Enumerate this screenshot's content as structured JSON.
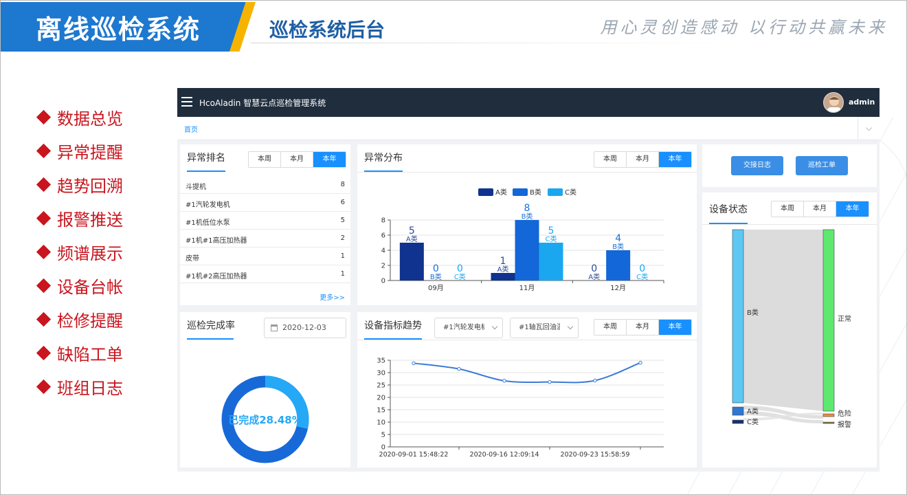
{
  "banner": {
    "title": "离线巡检系统",
    "subtitle": "巡检系统后台",
    "slogan": "用心灵创造感动 以行动共赢未来",
    "colors": {
      "blue": "#1d78cf",
      "yellow": "#f6b400"
    }
  },
  "features": [
    "数据总览",
    "异常提醒",
    "趋势回溯",
    "报警推送",
    "频谱展示",
    "设备台帐",
    "检修提醒",
    "缺陷工单",
    "班组日志"
  ],
  "app": {
    "title": "HcoAladin 智慧云点巡检管理系统",
    "user": "admin",
    "menu_icon": "hamburger-icon",
    "home_tab": "首页",
    "period_options": [
      "本周",
      "本月",
      "本年"
    ],
    "active_period": "本年",
    "anomaly_ranking": {
      "title": "异常排名",
      "rows": [
        {
          "name": "斗提机",
          "value": "8"
        },
        {
          "name": "#1汽轮发电机",
          "value": "6"
        },
        {
          "name": "#1机低位水泵",
          "value": "5"
        },
        {
          "name": "#1机#1高压加热器",
          "value": "2"
        },
        {
          "name": "皮带",
          "value": "1"
        },
        {
          "name": "#1机#2高压加热器",
          "value": "1"
        }
      ],
      "more": "更多>>"
    },
    "completion": {
      "title": "巡检完成率",
      "date": "2020-12-03",
      "label": "已完成28.48%",
      "ratio": 0.2848
    },
    "actions": {
      "handover_log": "交接日志",
      "work_order": "巡检工单"
    },
    "device_status": {
      "title": "设备状态"
    },
    "anomaly_distribution": {
      "title": "异常分布"
    },
    "device_trend": {
      "title": "设备指标趋势",
      "device_select": "#1汽轮发电机",
      "metric_select": "#1轴瓦回油温度"
    }
  },
  "chart_data": [
    {
      "type": "bar",
      "categories": [
        "09月",
        "11月",
        "12月"
      ],
      "series": [
        {
          "name": "A类",
          "values": [
            5,
            1,
            0
          ],
          "color": "#10338f"
        },
        {
          "name": "B类",
          "values": [
            0,
            8,
            4
          ],
          "color": "#1367d8"
        },
        {
          "name": "C类",
          "values": [
            0,
            5,
            0
          ],
          "color": "#1aa7f0"
        }
      ],
      "yticks": [
        "0",
        "2",
        "4",
        "6",
        "8"
      ],
      "ylim": [
        0,
        8
      ],
      "legend": "top-center",
      "grid": true
    },
    {
      "type": "line",
      "x": [
        "2020-09-01 15:48:22",
        "",
        "2020-09-16 12:09:14",
        "",
        "2020-09-23 15:58:59",
        ""
      ],
      "xtick_labels": [
        "2020-09-01 15:48:22",
        "2020-09-16 12:09:14",
        "2020-09-23 15:58:59"
      ],
      "series": [
        {
          "values": [
            33.8,
            31.5,
            26.7,
            26.2,
            26.8,
            34.0
          ],
          "color": "#3a7bd5"
        }
      ],
      "yticks": [
        "0",
        "5",
        "10",
        "15",
        "20",
        "25",
        "30",
        "35"
      ],
      "ylim": [
        0,
        35
      ],
      "grid": true
    },
    {
      "type": "sankey",
      "sources": [
        {
          "name": "B类",
          "value": 150,
          "color": "#5ec8f2"
        },
        {
          "name": "A类",
          "value": 6,
          "color": "#2f77d0"
        },
        {
          "name": "C类",
          "value": 3,
          "color": "#17306e"
        }
      ],
      "targets": [
        {
          "name": "正常",
          "value": 150,
          "color": "#5fe86e"
        },
        {
          "name": "危险",
          "value": 3,
          "color": "#ef8a3c"
        },
        {
          "name": "报警",
          "value": 2,
          "color": "#8c6d33"
        }
      ]
    }
  ]
}
